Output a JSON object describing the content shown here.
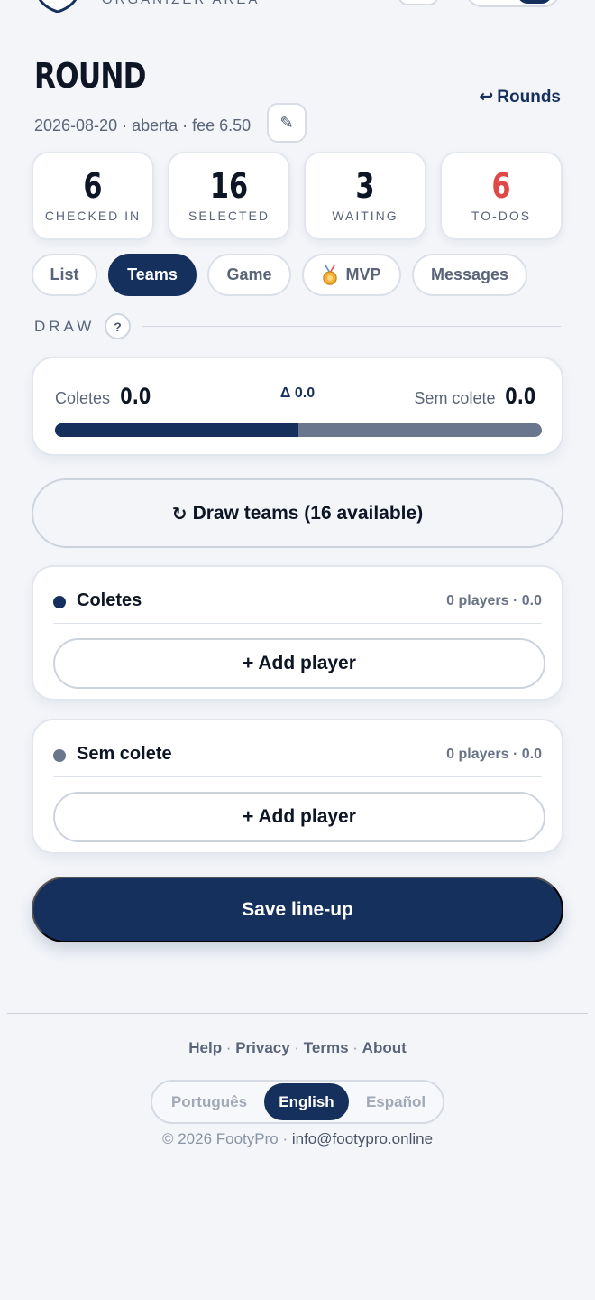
{
  "header": {
    "organizer_label": "ORGANIZER AREA"
  },
  "round": {
    "title": "ROUND",
    "back_label": "Rounds",
    "meta": "2026-08-20 · aberta · fee 6.50"
  },
  "stats": [
    {
      "value": "6",
      "label": "CHECKED IN",
      "color": "#0e1626"
    },
    {
      "value": "16",
      "label": "SELECTED",
      "color": "#0e1626"
    },
    {
      "value": "3",
      "label": "WAITING",
      "color": "#0e1626"
    },
    {
      "value": "6",
      "label": "TO-DOS",
      "color": "#e04848"
    }
  ],
  "tabs": [
    {
      "label": "List",
      "active": false
    },
    {
      "label": "Teams",
      "active": true
    },
    {
      "label": "Game",
      "active": false
    },
    {
      "label": "MVP",
      "active": false,
      "icon": "medal-icon"
    },
    {
      "label": "Messages",
      "active": false
    }
  ],
  "draw_section": {
    "label": "DRAW",
    "help": "?"
  },
  "balance": {
    "left_name": "Coletes",
    "left_score": "0.0",
    "delta": "Δ 0.0",
    "right_name": "Sem colete",
    "right_score": "0.0",
    "left_share": 0.5
  },
  "draw_button": {
    "icon": "↻",
    "label": "Draw teams (16 available)"
  },
  "teams": [
    {
      "name": "Coletes",
      "count": "0 players · 0.0",
      "dot_color": "#16305e",
      "add_label": "+ Add player"
    },
    {
      "name": "Sem colete",
      "count": "0 players · 0.0",
      "dot_color": "#6a768d",
      "add_label": "+ Add player"
    }
  ],
  "save_button": {
    "label": "Save line-up"
  },
  "footer": {
    "links": [
      "Help",
      "Privacy",
      "Terms",
      "About"
    ],
    "languages": [
      {
        "label": "Português",
        "active": false
      },
      {
        "label": "English",
        "active": true
      },
      {
        "label": "Español",
        "active": false
      }
    ],
    "copyright": "© 2026 FootyPro · ",
    "email": "info@footypro.online"
  },
  "colors": {
    "primary": "#16305e",
    "secondary_team": "#6a768d",
    "alert": "#e04848",
    "background": "#f3f5f9"
  }
}
